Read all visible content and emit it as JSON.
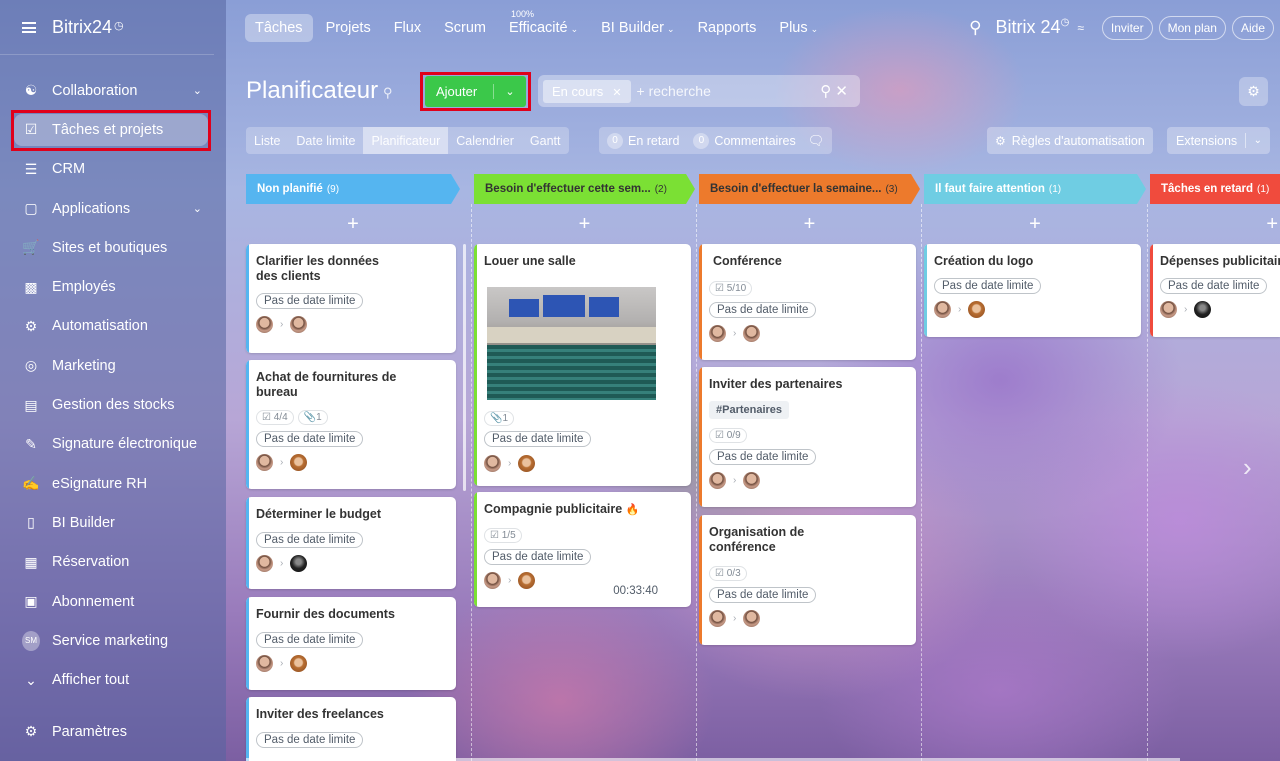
{
  "sidebar": {
    "logo": "Bitrix24",
    "items": [
      {
        "label": "Collaboration"
      },
      {
        "label": "Tâches et projets"
      },
      {
        "label": "CRM"
      },
      {
        "label": "Applications"
      },
      {
        "label": "Sites et boutiques"
      },
      {
        "label": "Employés"
      },
      {
        "label": "Automatisation"
      },
      {
        "label": "Marketing"
      },
      {
        "label": "Gestion des stocks"
      },
      {
        "label": "Signature électronique"
      },
      {
        "label": "eSignature RH"
      },
      {
        "label": "BI Builder"
      },
      {
        "label": "Réservation"
      },
      {
        "label": "Abonnement"
      },
      {
        "label": "Service marketing",
        "badge": "SM"
      },
      {
        "label": "Afficher tout"
      }
    ],
    "settings": "Paramètres"
  },
  "topnav": {
    "items": [
      "Tâches",
      "Projets",
      "Flux",
      "Scrum",
      "Efficacité",
      "BI Builder",
      "Rapports",
      "Plus"
    ],
    "efficiency_value": "100%",
    "brand": "Bitrix 24",
    "invite": "Inviter",
    "plan": "Mon plan",
    "help": "Aide"
  },
  "header": {
    "title": "Planificateur",
    "add_button": "Ajouter",
    "filter_chip": "En cours",
    "search_placeholder": "+ recherche"
  },
  "views": [
    "Liste",
    "Date limite",
    "Planificateur",
    "Calendrier",
    "Gantt"
  ],
  "counters": {
    "overdue_count": "0",
    "overdue_label": "En retard",
    "comments_count": "0",
    "comments_label": "Commentaires"
  },
  "automation": "Règles d'automatisation",
  "extensions": "Extensions",
  "columns": [
    {
      "title": "Non planifié",
      "count": "(9)",
      "color": "#55b5f0"
    },
    {
      "title": "Besoin d'effectuer cette sem...",
      "count": "(2)",
      "color": "#7be034"
    },
    {
      "title": "Besoin d'effectuer la semaine...",
      "count": "(3)",
      "color": "#ed7a2c"
    },
    {
      "title": "Il faut faire attention",
      "count": "(1)",
      "color": "#6fcde3"
    },
    {
      "title": "Tâches en retard",
      "count": "(1)",
      "color": "#f04b3d"
    }
  ],
  "no_deadline": "Pas de date limite",
  "cards": {
    "c1": {
      "title": "Clarifier les données des clients"
    },
    "c2": {
      "title": "Achat de fournitures de bureau",
      "checklist": "4/4",
      "files": "1"
    },
    "c3": {
      "title": "Déterminer le budget"
    },
    "c4": {
      "title": "Fournir des documents"
    },
    "c5": {
      "title": "Inviter des freelances"
    },
    "c6": {
      "title": "Louer une salle",
      "files": "1"
    },
    "c7": {
      "title": "Compagnie publicitaire",
      "checklist": "1/5",
      "timer": "00:33:40"
    },
    "c8": {
      "title": "Conférence",
      "checklist": "5/10"
    },
    "c9": {
      "title": "Inviter des partenaires",
      "tag": "#Partenaires",
      "checklist": "0/9"
    },
    "c10": {
      "title": "Organisation de conférence",
      "checklist": "0/3"
    },
    "c11": {
      "title": "Création du logo"
    },
    "c12": {
      "title": "Dépenses publicitaires"
    }
  }
}
